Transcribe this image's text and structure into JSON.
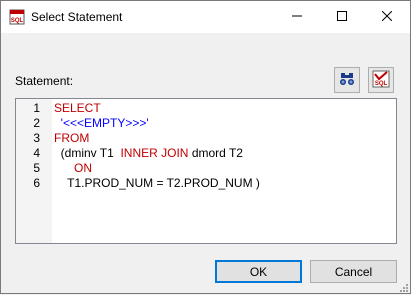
{
  "window": {
    "title": "Select Statement",
    "app_icon": "sql-icon",
    "controls": [
      "minimize-icon",
      "maximize-icon",
      "close-icon"
    ]
  },
  "statement": {
    "label": "Statement:",
    "tools": [
      "binoculars-icon",
      "sql-check-icon"
    ]
  },
  "editor": {
    "lines": [
      {
        "num": "1",
        "parts": [
          {
            "t": "SELECT",
            "c": "kw"
          }
        ]
      },
      {
        "num": "2",
        "parts": [
          {
            "t": "  ",
            "c": ""
          },
          {
            "t": "'<<<EMPTY>>>'",
            "c": "str"
          }
        ]
      },
      {
        "num": "3",
        "parts": [
          {
            "t": "FROM",
            "c": "kw"
          }
        ]
      },
      {
        "num": "4",
        "parts": [
          {
            "t": "  (dminv T1  ",
            "c": ""
          },
          {
            "t": "INNER JOIN",
            "c": "kw"
          },
          {
            "t": " dmord T2",
            "c": ""
          }
        ]
      },
      {
        "num": "5",
        "parts": [
          {
            "t": "      ",
            "c": ""
          },
          {
            "t": "ON",
            "c": "kw"
          }
        ]
      },
      {
        "num": "6",
        "parts": [
          {
            "t": "    T1.PROD_NUM = T2.PROD_NUM )",
            "c": ""
          }
        ]
      }
    ]
  },
  "buttons": {
    "ok": "OK",
    "cancel": "Cancel"
  },
  "colors": {
    "keyword": "#c00000",
    "string": "#0000ff",
    "accent": "#0078d7"
  }
}
